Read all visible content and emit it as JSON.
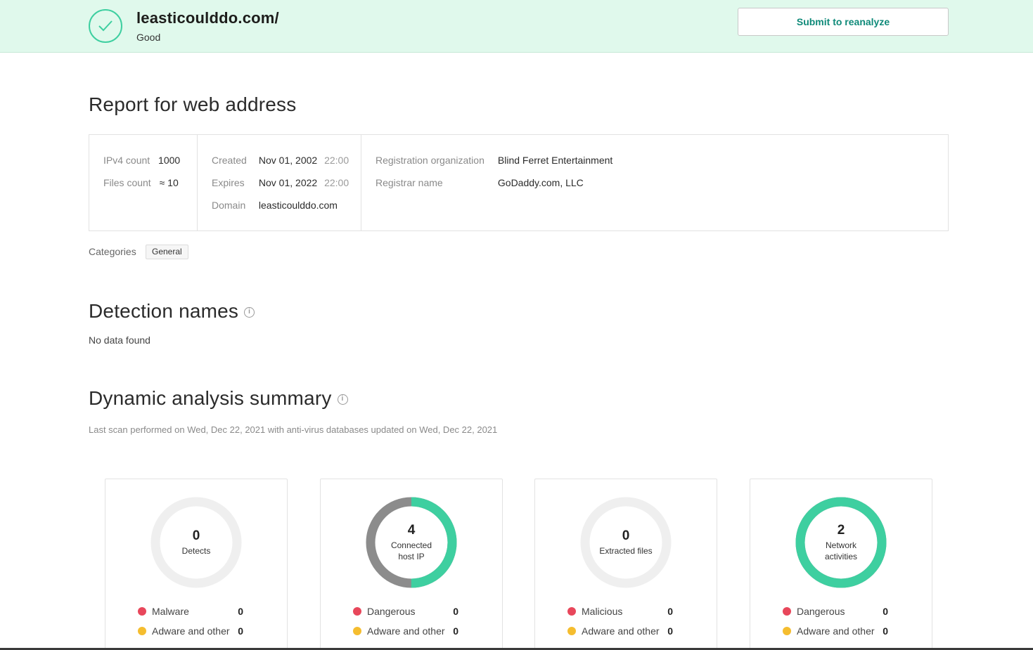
{
  "header": {
    "url": "leasticoulddo.com/",
    "status": "Good",
    "reanalyze_label": "Submit to reanalyze"
  },
  "report": {
    "title": "Report for web address",
    "col1": [
      {
        "label": "IPv4 count",
        "value": "1000"
      },
      {
        "label": "Files count",
        "value": "≈ 10"
      }
    ],
    "col2": [
      {
        "label": "Created",
        "value": "Nov 01, 2002",
        "time": "22:00"
      },
      {
        "label": "Expires",
        "value": "Nov 01, 2022",
        "time": "22:00"
      },
      {
        "label": "Domain",
        "value": "leasticoulddo.com"
      }
    ],
    "col3": [
      {
        "label": "Registration organization",
        "value": "Blind Ferret Entertainment"
      },
      {
        "label": "Registrar name",
        "value": "GoDaddy.com, LLC"
      }
    ],
    "categories_label": "Categories",
    "category_tag": "General"
  },
  "detection": {
    "title": "Detection names",
    "info_icon": "info-icon",
    "empty_text": "No data found"
  },
  "dynamic": {
    "title": "Dynamic analysis summary",
    "info_icon": "info-icon",
    "scan_text": "Last scan performed on Wed, Dec 22, 2021 with anti-virus databases updated on Wed, Dec 22, 2021",
    "cards": [
      {
        "value": "0",
        "label_line1": "Detects",
        "label_line2": "",
        "green_fraction": 0,
        "legend": [
          {
            "label": "Malware",
            "count": "0"
          },
          {
            "label": "Adware and other",
            "count": "0"
          }
        ]
      },
      {
        "value": "4",
        "label_line1": "Connected",
        "label_line2": "host IP",
        "green_fraction": 0.5,
        "legend": [
          {
            "label": "Dangerous",
            "count": "0"
          },
          {
            "label": "Adware and other",
            "count": "0"
          }
        ]
      },
      {
        "value": "0",
        "label_line1": "Extracted files",
        "label_line2": "",
        "green_fraction": 0,
        "legend": [
          {
            "label": "Malicious",
            "count": "0"
          },
          {
            "label": "Adware and other",
            "count": "0"
          }
        ]
      },
      {
        "value": "2",
        "label_line1": "Network",
        "label_line2": "activities",
        "green_fraction": 1,
        "legend": [
          {
            "label": "Dangerous",
            "count": "0"
          },
          {
            "label": "Adware and other",
            "count": "0"
          }
        ]
      }
    ]
  },
  "colors": {
    "good": "#3ecfa0",
    "gray_ring": "#8c8c8c",
    "empty_ring": "#efefef",
    "red_dot": "#e8475b",
    "yellow_dot": "#f5bd2f"
  }
}
